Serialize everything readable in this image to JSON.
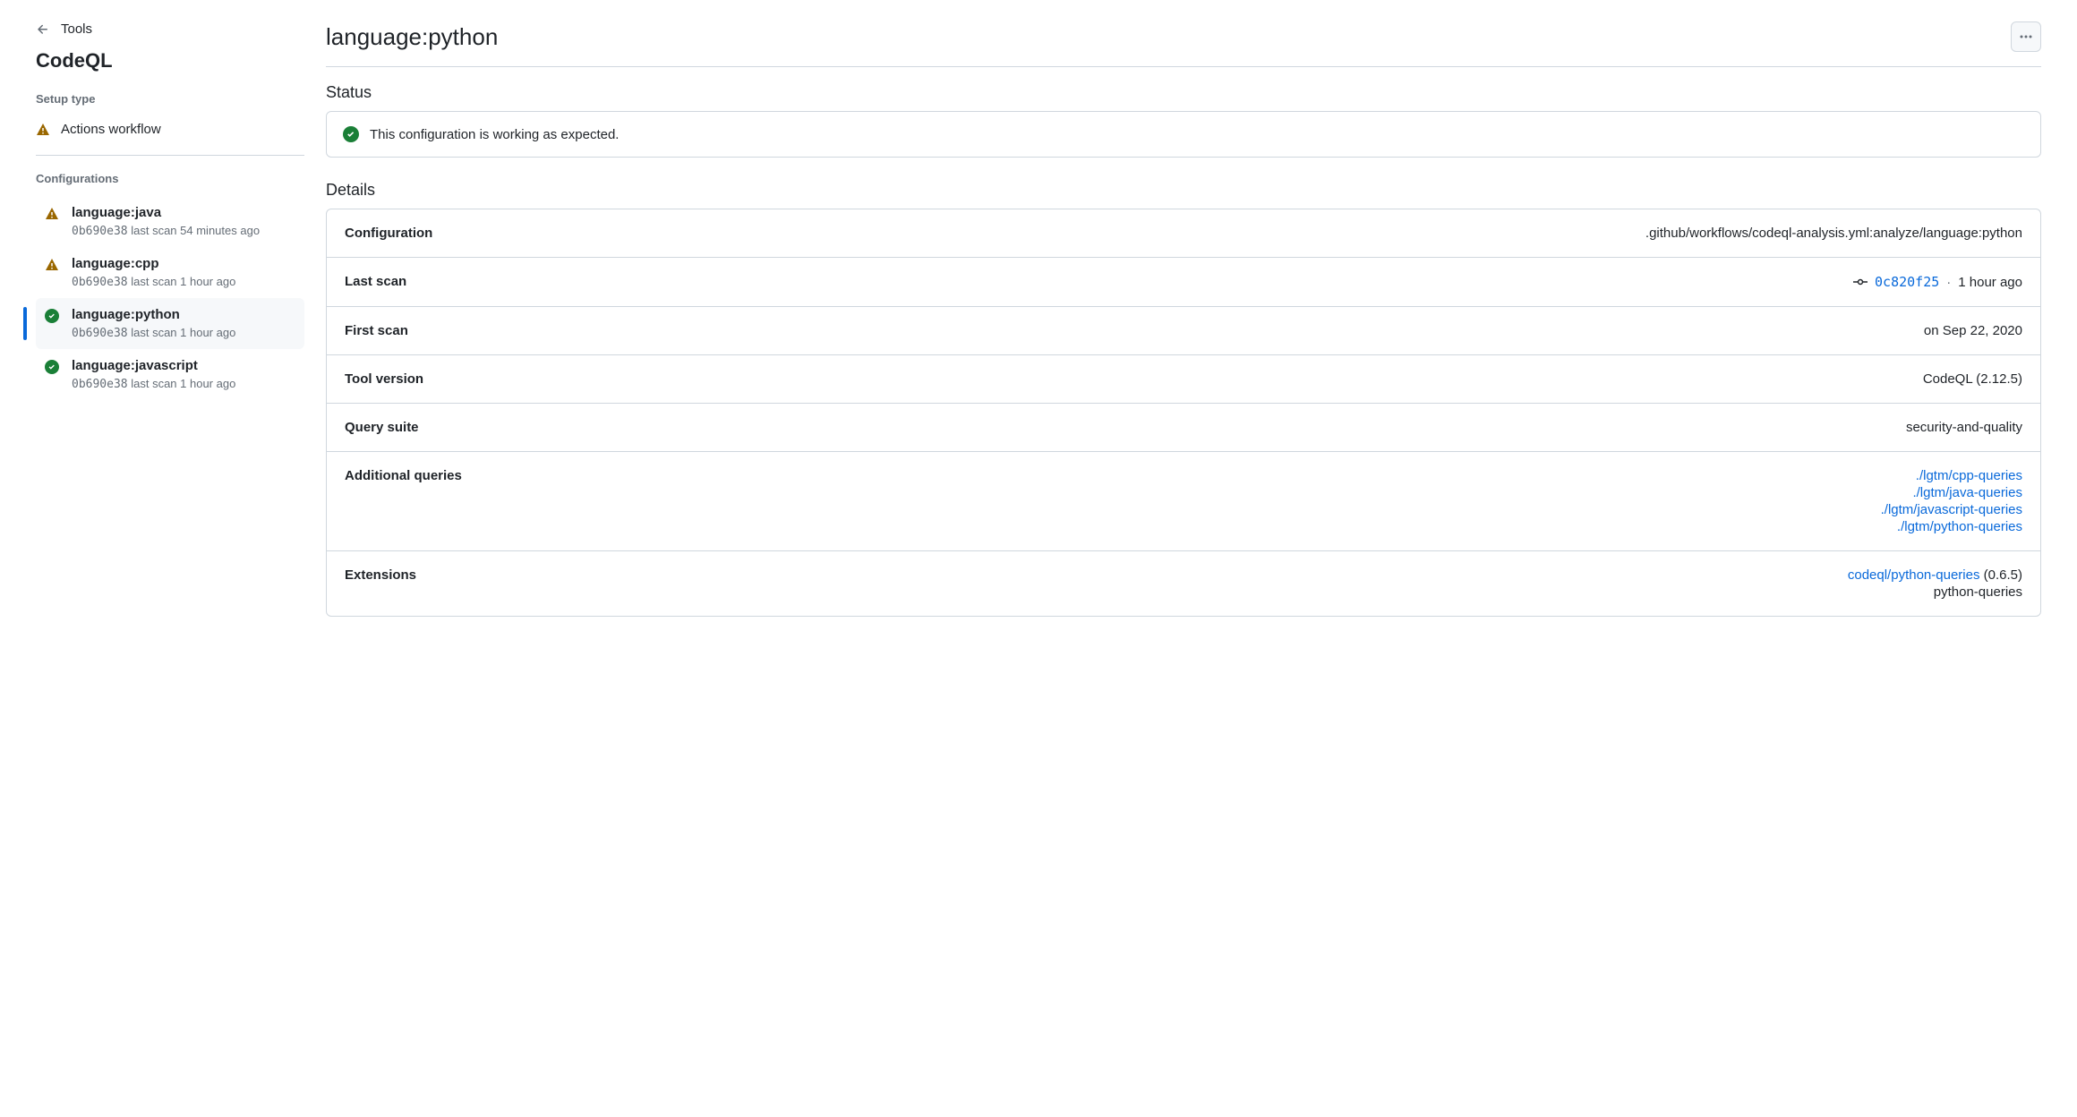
{
  "sidebar": {
    "back_label": "Tools",
    "title": "CodeQL",
    "setup_label": "Setup type",
    "setup_value": "Actions workflow",
    "config_label": "Configurations",
    "configs": [
      {
        "name": "language:java",
        "sha": "0b690e38",
        "meta": "last scan 54 minutes ago",
        "status": "warn",
        "selected": false
      },
      {
        "name": "language:cpp",
        "sha": "0b690e38",
        "meta": "last scan 1 hour ago",
        "status": "warn",
        "selected": false
      },
      {
        "name": "language:python",
        "sha": "0b690e38",
        "meta": "last scan 1 hour ago",
        "status": "success",
        "selected": true
      },
      {
        "name": "language:javascript",
        "sha": "0b690e38",
        "meta": "last scan 1 hour ago",
        "status": "success",
        "selected": false
      }
    ]
  },
  "main": {
    "title": "language:python",
    "status_heading": "Status",
    "status_message": "This configuration is working as expected.",
    "details_heading": "Details",
    "rows": {
      "configuration": {
        "label": "Configuration",
        "value": ".github/workflows/codeql-analysis.yml:analyze/language:python"
      },
      "last_scan": {
        "label": "Last scan",
        "commit": "0c820f25",
        "sep": "·",
        "when": "1 hour ago"
      },
      "first_scan": {
        "label": "First scan",
        "value": "on Sep 22, 2020"
      },
      "tool_version": {
        "label": "Tool version",
        "value": "CodeQL (2.12.5)"
      },
      "query_suite": {
        "label": "Query suite",
        "value": "security-and-quality"
      },
      "addl_queries": {
        "label": "Additional queries",
        "items": [
          "./lgtm/cpp-queries",
          "./lgtm/java-queries",
          "./lgtm/javascript-queries",
          "./lgtm/python-queries"
        ]
      },
      "extensions": {
        "label": "Extensions",
        "link": "codeql/python-queries",
        "version": "(0.6.5)",
        "plain": "python-queries"
      }
    }
  }
}
